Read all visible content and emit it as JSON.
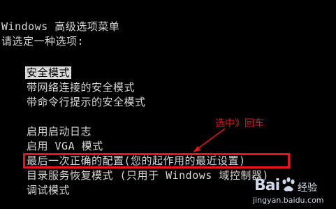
{
  "menu": {
    "title": "Windows 高级选项菜单",
    "prompt": "请选定一种选项:",
    "items": [
      {
        "label": "安全模式",
        "selected": true
      },
      {
        "label": "带网络连接的安全模式"
      },
      {
        "label": "带命令行提示的安全模式"
      },
      {
        "label": "启用启动日志"
      },
      {
        "label": "启用 VGA 模式"
      },
      {
        "label": "最后一次正确的配置(您的起作用的最近设置)",
        "highlighted": true
      },
      {
        "label": "目录服务恢复模式 (只用于 Windows 域控制器)"
      },
      {
        "label": "调试模式"
      }
    ]
  },
  "annotation": {
    "text": "选中》回车",
    "color": "#e8141a"
  },
  "watermark": {
    "brand": "Bai度经验",
    "logo_text": "Bai",
    "name": "经验",
    "url": "jingyan.baidu.com"
  },
  "colors": {
    "background": "#000000",
    "text": "#d8d8d8",
    "annotation": "#e8141a"
  }
}
